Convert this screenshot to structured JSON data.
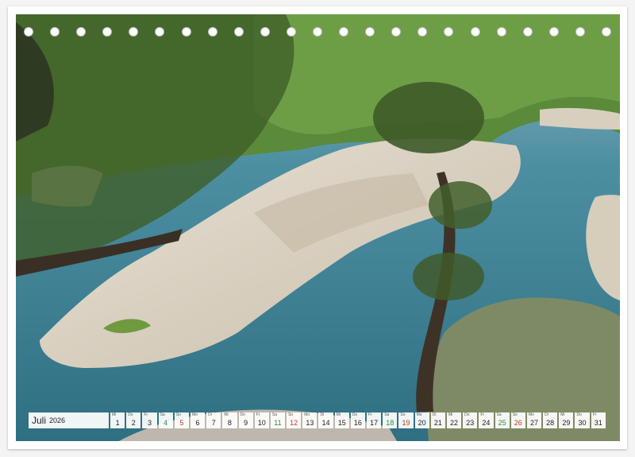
{
  "calendar": {
    "month": "Juli",
    "year": "2026",
    "days": [
      {
        "wd": "Mi",
        "d": "1",
        "type": "normal"
      },
      {
        "wd": "Do",
        "d": "2",
        "type": "normal"
      },
      {
        "wd": "Fr",
        "d": "3",
        "type": "normal"
      },
      {
        "wd": "Sa",
        "d": "4",
        "type": "we"
      },
      {
        "wd": "So",
        "d": "5",
        "type": "sun"
      },
      {
        "wd": "Mo",
        "d": "6",
        "type": "normal"
      },
      {
        "wd": "Di",
        "d": "7",
        "type": "normal"
      },
      {
        "wd": "Mi",
        "d": "8",
        "type": "normal"
      },
      {
        "wd": "Do",
        "d": "9",
        "type": "normal"
      },
      {
        "wd": "Fr",
        "d": "10",
        "type": "normal"
      },
      {
        "wd": "Sa",
        "d": "11",
        "type": "we"
      },
      {
        "wd": "So",
        "d": "12",
        "type": "sun"
      },
      {
        "wd": "Mo",
        "d": "13",
        "type": "normal"
      },
      {
        "wd": "Di",
        "d": "14",
        "type": "normal"
      },
      {
        "wd": "Mi",
        "d": "15",
        "type": "normal"
      },
      {
        "wd": "Do",
        "d": "16",
        "type": "normal"
      },
      {
        "wd": "Fr",
        "d": "17",
        "type": "normal"
      },
      {
        "wd": "Sa",
        "d": "18",
        "type": "we"
      },
      {
        "wd": "So",
        "d": "19",
        "type": "sun"
      },
      {
        "wd": "Mo",
        "d": "20",
        "type": "normal"
      },
      {
        "wd": "Di",
        "d": "21",
        "type": "normal"
      },
      {
        "wd": "Mi",
        "d": "22",
        "type": "normal"
      },
      {
        "wd": "Do",
        "d": "23",
        "type": "normal"
      },
      {
        "wd": "Fr",
        "d": "24",
        "type": "normal"
      },
      {
        "wd": "Sa",
        "d": "25",
        "type": "we"
      },
      {
        "wd": "So",
        "d": "26",
        "type": "sun"
      },
      {
        "wd": "Mo",
        "d": "27",
        "type": "normal"
      },
      {
        "wd": "Di",
        "d": "28",
        "type": "normal"
      },
      {
        "wd": "Mi",
        "d": "29",
        "type": "normal"
      },
      {
        "wd": "Do",
        "d": "30",
        "type": "normal"
      },
      {
        "wd": "Fr",
        "d": "31",
        "type": "normal"
      }
    ]
  },
  "binding": {
    "hole_count": 23
  },
  "colors": {
    "water": "#3c8194",
    "rock": "#d9d0bf",
    "foliage": "#4f7a32",
    "weekend": "#2e8b3d",
    "sunday": "#c0392b"
  }
}
